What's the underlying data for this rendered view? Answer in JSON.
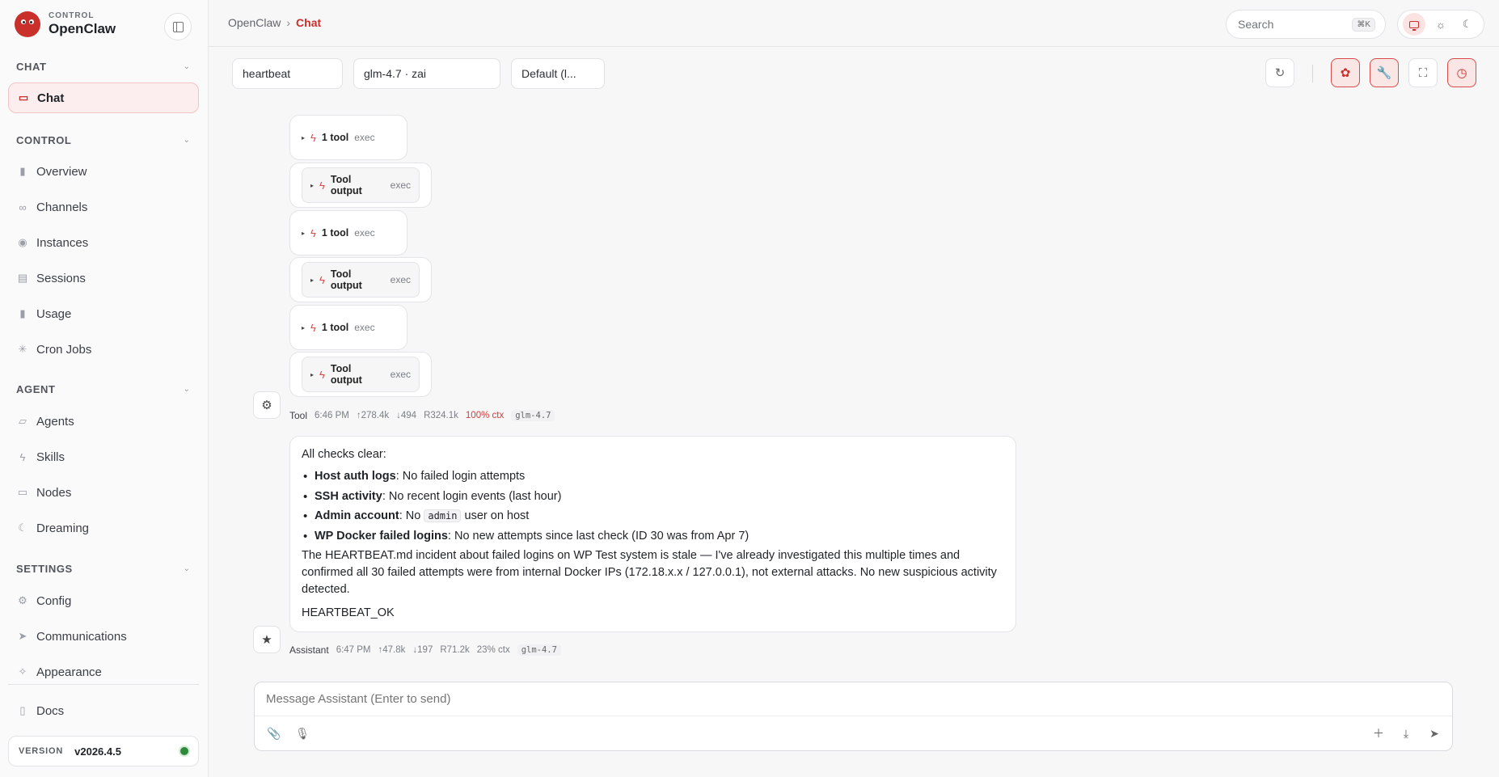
{
  "brand": {
    "small": "CONTROL",
    "name": "OpenClaw"
  },
  "sections": {
    "chat": "CHAT",
    "control": "CONTROL",
    "agent": "AGENT",
    "settings": "SETTINGS"
  },
  "nav": {
    "chat": "Chat",
    "overview": "Overview",
    "channels": "Channels",
    "instances": "Instances",
    "sessions": "Sessions",
    "usage": "Usage",
    "cron": "Cron Jobs",
    "agents": "Agents",
    "skills": "Skills",
    "nodes": "Nodes",
    "dreaming": "Dreaming",
    "config": "Config",
    "communications": "Communications",
    "appearance": "Appearance",
    "docs": "Docs"
  },
  "version": {
    "label": "VERSION",
    "value": "v2026.4.5"
  },
  "header": {
    "crumb_root": "OpenClaw",
    "crumb_sep": "›",
    "crumb_current": "Chat",
    "search_placeholder": "Search",
    "search_shortcut": "⌘K"
  },
  "toolbar": {
    "session": "heartbeat",
    "model": "glm-4.7 · zai",
    "profile": "Default (l..."
  },
  "tools": [
    {
      "label": "1 tool",
      "kind": "exec"
    },
    {
      "label": "Tool output",
      "kind": "exec"
    },
    {
      "label": "1 tool",
      "kind": "exec"
    },
    {
      "label": "Tool output",
      "kind": "exec"
    },
    {
      "label": "1 tool",
      "kind": "exec"
    },
    {
      "label": "Tool output",
      "kind": "exec"
    }
  ],
  "tool_meta": {
    "who": "Tool",
    "time": "6:46 PM",
    "up": "↑278.4k",
    "down": "↓494",
    "r": "R324.1k",
    "ctx": "100% ctx",
    "model": "glm-4.7"
  },
  "message": {
    "intro": "All checks clear:",
    "items": [
      {
        "b": "Host auth logs",
        "t": ": No failed login attempts"
      },
      {
        "b": "SSH activity",
        "t": ": No recent login events (last hour)"
      },
      {
        "b": "Admin account",
        "t1": ": No ",
        "code": "admin",
        "t2": " user on host"
      },
      {
        "b": "WP Docker failed logins",
        "t": ": No new attempts since last check (ID 30 was from Apr 7)"
      }
    ],
    "para": "The HEARTBEAT.md incident about failed logins on WP Test system is stale — I've already investigated this multiple times and confirmed all 30 failed attempts were from internal Docker IPs (172.18.x.x / 127.0.0.1), not external attacks. No new suspicious activity detected.",
    "ok": "HEARTBEAT_OK"
  },
  "assistant_meta": {
    "who": "Assistant",
    "time": "6:47 PM",
    "up": "↑47.8k",
    "down": "↓197",
    "r": "R71.2k",
    "ctx": "23% ctx",
    "model": "glm-4.7"
  },
  "composer": {
    "placeholder": "Message Assistant (Enter to send)"
  },
  "colors": {
    "accent": "#c9302c",
    "status_ok": "#2e8b3c"
  },
  "icons": {
    "nav": [
      "chat-bubble-icon",
      "bar-chart-icon",
      "link-icon",
      "radio-icon",
      "file-icon",
      "bar-chart-icon",
      "loader-icon",
      "folder-icon",
      "bolt-icon",
      "monitor-icon",
      "moon-icon",
      "gear-icon",
      "send-icon",
      "sparkle-icon",
      "book-icon"
    ],
    "toolbar": [
      "refresh-icon",
      "brain-icon",
      "wrench-icon",
      "focus-icon",
      "clock-icon"
    ]
  }
}
